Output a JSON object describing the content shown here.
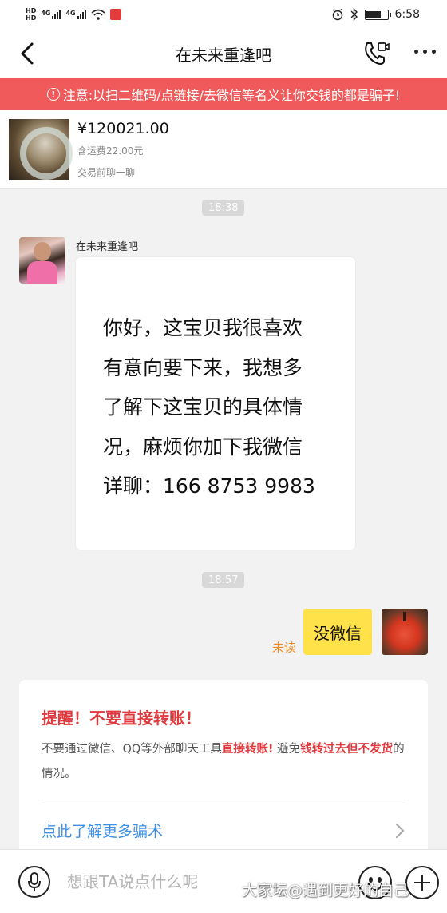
{
  "status_bar": {
    "hd1": "HD",
    "hd2": "HD",
    "net1": "4G",
    "net2": "4G",
    "time": "6:58",
    "icons": [
      "alarm-icon",
      "bluetooth-icon",
      "battery-icon"
    ]
  },
  "nav": {
    "title": "在未来重逢吧",
    "icons": [
      "back-arrow-icon",
      "voice-video-call-icon",
      "more-icon"
    ]
  },
  "warning_banner": {
    "text": "注意:以扫二维码/点链接/去微信等名义让你交钱的都是骗子!"
  },
  "product": {
    "price": "¥120021.00",
    "shipping": "含运费22.00元",
    "hint": "交易前聊一聊"
  },
  "messages": {
    "time1": "18:38",
    "sender_name": "在未来重逢吧",
    "image_text": "你好，这宝贝我很喜欢\n有意向要下来，我想多\n了解下这宝贝的具体情\n况，麻烦你加下我微信\n详聊：166 8753 9983",
    "time2": "18:57",
    "reply_text": "没微信",
    "reply_status": "未读"
  },
  "reminder": {
    "title": "提醒！不要直接转账！",
    "body_part1": "不要通过微信、QQ等外部聊天工具",
    "body_hl1": "直接转账!",
    "body_part2": " 避免",
    "body_hl2": "钱转过去但不发货",
    "body_part3": "的情况。",
    "link": "点此了解更多骗术"
  },
  "input_bar": {
    "placeholder": "想跟TA说点什么呢"
  },
  "watermark": {
    "text": "大家坛@遇到更好的自己"
  },
  "colors": {
    "banner_red": "#f05a5a",
    "alert_red": "#e0393e",
    "link_blue": "#3d8fe4",
    "bubble_yellow": "#ffe14a",
    "unread_orange": "#f08b24"
  }
}
